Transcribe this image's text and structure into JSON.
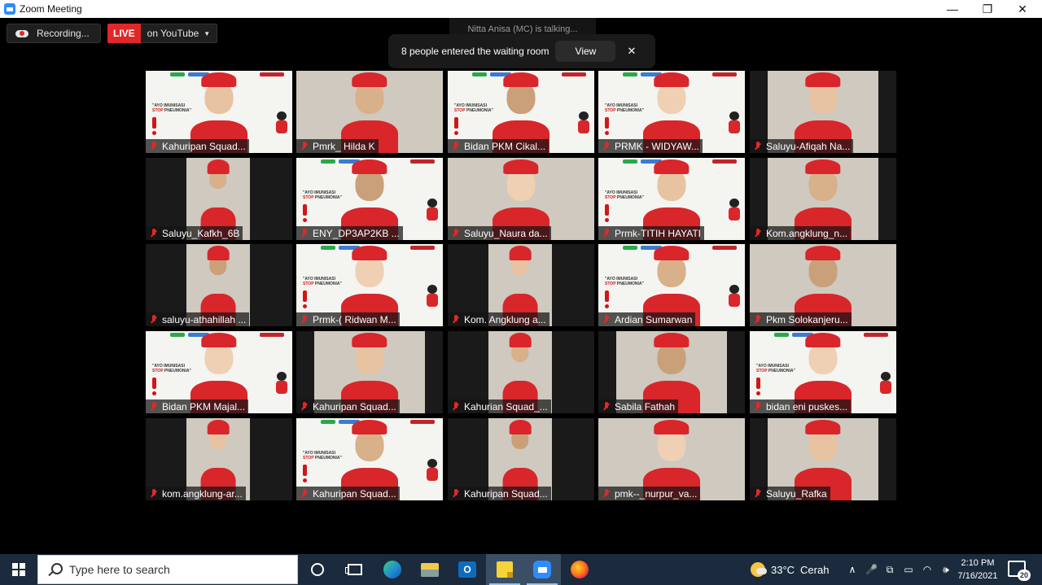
{
  "window": {
    "title": "Zoom Meeting",
    "controls": {
      "minimize": "—",
      "maximize": "❐",
      "close": "✕"
    }
  },
  "meeting": {
    "recording_label": "Recording...",
    "live_badge": "LIVE",
    "live_target": "on YouTube",
    "talking_indicator": "Nitta Anisa (MC) is talking...",
    "waiting_toast": {
      "message": "8 people entered the waiting room",
      "view_label": "View",
      "close_label": "✕"
    }
  },
  "participants": [
    {
      "name": "Kahuripan Squad...",
      "scene": "slide"
    },
    {
      "name": "Pmrk_ Hilda K",
      "scene": "room"
    },
    {
      "name": "Bidan PKM Cikal...",
      "scene": "slide"
    },
    {
      "name": "PRMK - WIDYAW...",
      "scene": "slide"
    },
    {
      "name": "Saluyu-Afiqah Na...",
      "scene": "room"
    },
    {
      "name": "Saluyu_Kafkh_6B",
      "scene": "room"
    },
    {
      "name": "ENY_DP3AP2KB ...",
      "scene": "slide"
    },
    {
      "name": "Saluyu_Naura da...",
      "scene": "room"
    },
    {
      "name": "Prmk-TITIH HAYATI",
      "scene": "slide"
    },
    {
      "name": "Kom.angklung_n...",
      "scene": "room"
    },
    {
      "name": "saluyu-athahillah ...",
      "scene": "room"
    },
    {
      "name": "Prmk-( Ridwan M...",
      "scene": "slide"
    },
    {
      "name": "Kom. Angklung a...",
      "scene": "room"
    },
    {
      "name": "Ardian Sumarwan",
      "scene": "slide"
    },
    {
      "name": "Pkm Solokanjeru...",
      "scene": "room"
    },
    {
      "name": "Bidan PKM Majal...",
      "scene": "slide"
    },
    {
      "name": "Kahuripan Squad...",
      "scene": "room"
    },
    {
      "name": "Kahurian Squad_...",
      "scene": "room"
    },
    {
      "name": "Sabila Fathah",
      "scene": "room"
    },
    {
      "name": "bidan eni puskes...",
      "scene": "slide"
    },
    {
      "name": "kom.angklung-ar...",
      "scene": "room"
    },
    {
      "name": "Kahuripan Squad...",
      "scene": "slide"
    },
    {
      "name": "Kahuripan Squad...",
      "scene": "room"
    },
    {
      "name": "pmk--_nurpur_va...",
      "scene": "room"
    },
    {
      "name": "Saluyu_Rafka",
      "scene": "room"
    }
  ],
  "slide_text": {
    "line1": "\"AYO IMUNISASI",
    "line2": "STOP",
    "line3": "PNEUMONIA\""
  },
  "taskbar": {
    "search_placeholder": "Type here to search",
    "apps": [
      "cortana-icon",
      "task-view-icon",
      "edge-icon",
      "file-explorer-icon",
      "outlook-icon",
      "sticky-notes-icon",
      "zoom-icon",
      "firefox-icon"
    ],
    "outlook_letter": "O",
    "weather": {
      "temp": "33°C",
      "condition": "Cerah"
    },
    "tray": {
      "chevron": "∧",
      "mic": "🎤",
      "screen": "⧉",
      "battery": "▭",
      "wifi": "◠",
      "volume": "🕪"
    },
    "clock": {
      "time": "2:10 PM",
      "date": "7/16/2021"
    },
    "notification_count": "20"
  },
  "colors": {
    "accent": "#2d8cff",
    "live_red": "#e02828",
    "taskbar": "#1b2b3d"
  }
}
